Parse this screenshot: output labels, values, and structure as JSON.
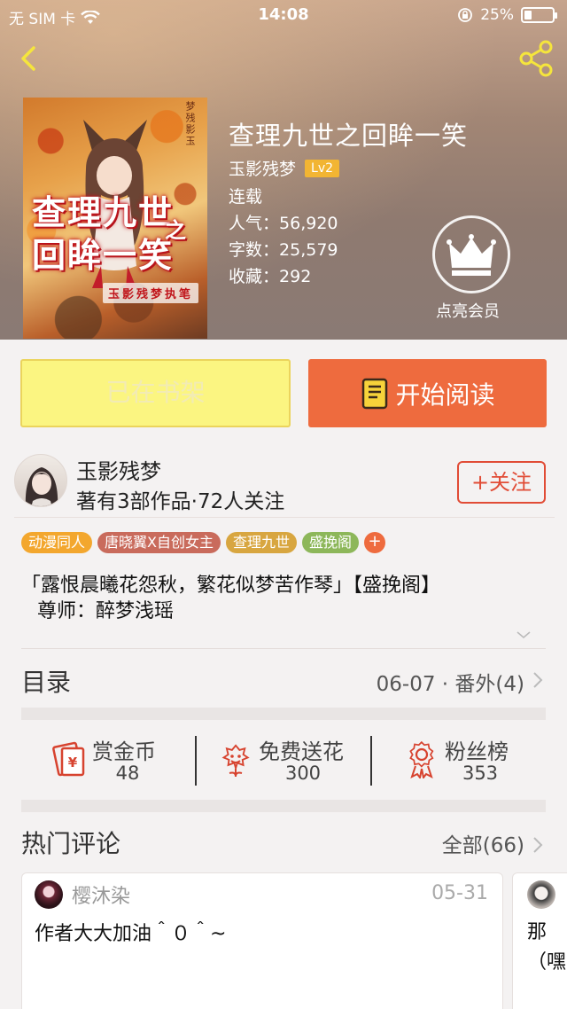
{
  "status_bar": {
    "carrier": "无 SIM 卡",
    "time": "14:08",
    "battery_percent": "25%",
    "battery_level": 0.25
  },
  "book": {
    "title": "查理九世之回眸一笑",
    "author": "玉影残梦",
    "level": "Lv2",
    "status": "连载",
    "popularity_label": "人气：",
    "popularity": "56,920",
    "words_label": "字数：",
    "words": "25,579",
    "favorites_label": "收藏：",
    "favorites": "292",
    "cover": {
      "title_line1": "查理九世",
      "title_line2": "回眸一笑",
      "title_mid": "之",
      "author_stamp": "玉影残梦执笔",
      "vertical_text": "梦残影玉"
    }
  },
  "member": {
    "label": "点亮会员"
  },
  "actions": {
    "shelf_label": "已在书架",
    "read_label": "开始阅读"
  },
  "author_card": {
    "name": "玉影残梦",
    "stats": "著有3部作品·72人关注",
    "follow_label": "+关注"
  },
  "tags": [
    {
      "label": "动漫同人",
      "color": "#f3a72e"
    },
    {
      "label": "唐晓翼X自创女主",
      "color": "#c96b5c"
    },
    {
      "label": "查理九世",
      "color": "#d8a640"
    },
    {
      "label": "盛挽阁",
      "color": "#8db75a"
    }
  ],
  "tag_more": "+",
  "intro": {
    "line1": "「露恨晨曦花怨秋，繁花似梦苦作琴」【盛挽阁】",
    "line2": "尊师：醉梦浅瑶"
  },
  "toc": {
    "label": "目录",
    "latest": "06-07 · 番外(4)"
  },
  "stats": [
    {
      "label": "赏金币",
      "value": "48"
    },
    {
      "label": "免费送花",
      "value": "300"
    },
    {
      "label": "粉丝榜",
      "value": "353"
    }
  ],
  "comments": {
    "label": "热门评论",
    "all_label": "全部(66)",
    "items": [
      {
        "user": "樱沐染",
        "date": "05-31",
        "text": "作者大大加油＾０＾~"
      },
      {
        "text": "那（嘿"
      }
    ]
  },
  "colors": {
    "accent": "#ee6b3e",
    "shelf_button": "#fbf581",
    "follow": "#e14c36",
    "icon_red": "#d7432f",
    "lv_badge": "#f2b533"
  }
}
